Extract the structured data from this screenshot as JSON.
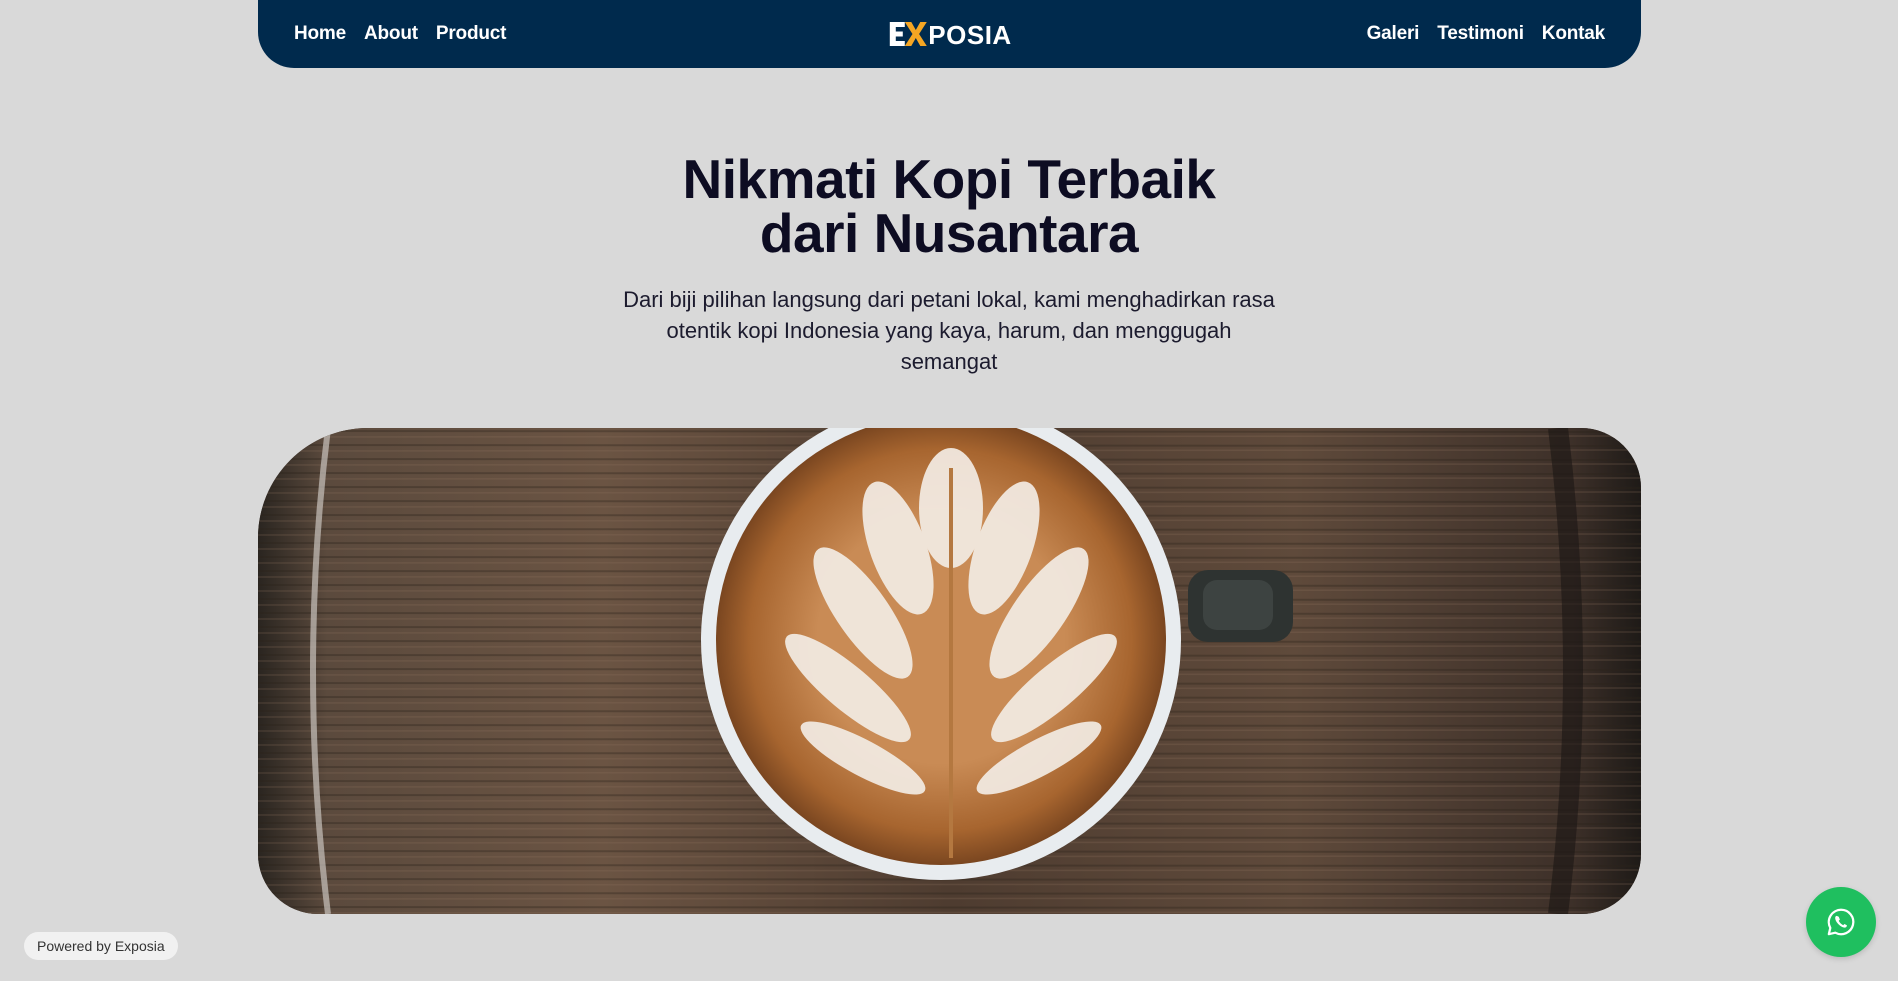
{
  "nav": {
    "left_links": [
      {
        "label": "Home"
      },
      {
        "label": "About"
      },
      {
        "label": "Product"
      }
    ],
    "right_links": [
      {
        "label": "Galeri"
      },
      {
        "label": "Testimoni"
      },
      {
        "label": "Kontak"
      }
    ],
    "logo": {
      "text": "POSIA",
      "mark": "EX",
      "mark_colors": {
        "e": "#ffffff",
        "x": "#f5a623"
      }
    },
    "background": "#002a4d"
  },
  "hero": {
    "title_line1": "Nikmati Kopi Terbaik",
    "title_line2": "dari Nusantara",
    "subtitle": "Dari biji pilihan langsung dari petani lokal, kami menghadirkan rasa otentik kopi Indonesia yang kaya, harum, dan menggugah semangat",
    "image": "latte-art-coffee-cup-on-wooden-table"
  },
  "footer": {
    "powered_by": "Powered by Exposia"
  },
  "whatsapp": {
    "icon": "whatsapp-icon",
    "color": "#1fbf5f"
  },
  "colors": {
    "page_background": "#d9d9d9",
    "heading": "#0d0c22",
    "accent": "#f5a623"
  }
}
